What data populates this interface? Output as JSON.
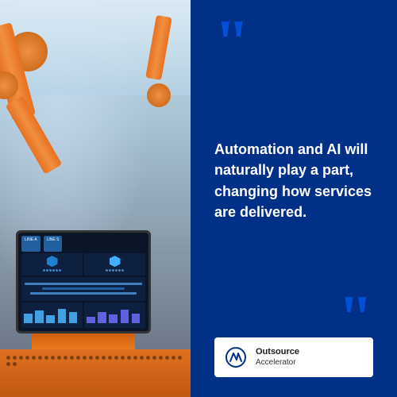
{
  "colors": {
    "blue_dark": "#003087",
    "blue_accent": "#0050d8",
    "orange": "#e87020",
    "white": "#ffffff",
    "black": "#1a1a1a"
  },
  "quote": {
    "open_mark": "“",
    "close_mark": "”",
    "text": "Automation and AI will naturally play a part, changing how services are delivered."
  },
  "logo": {
    "name": "Outsource",
    "tagline": "Accelerator"
  },
  "screen_tabs": [
    "LINE A",
    "LINE S"
  ],
  "floor_dots_count": 30
}
